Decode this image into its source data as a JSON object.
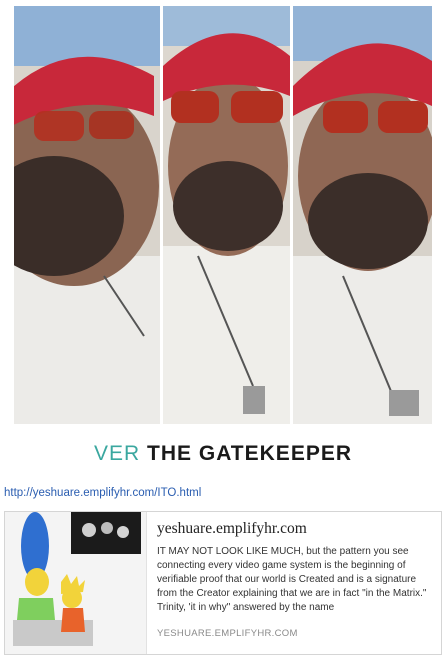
{
  "caption": {
    "prefix": "VER",
    "title": "THE GATEKEEPER"
  },
  "link": {
    "url": "http://yeshuare.emplifyhr.com/ITO.html"
  },
  "preview_card": {
    "title": "yeshuare.emplifyhr.com",
    "description": "IT MAY NOT LOOK LIKE MUCH, but the pattern you see connecting every video game system is the beginning of verifiable proof that our world is Created and is a signature from the Creator explaining that we are in fact \"in the Matrix.\"  Trinity, 'it in why\" answered by the name",
    "domain": "YESHUARE.EMPLIFYHR.COM",
    "thumbnail_icon": "simpsons-marge-lisa-illustration"
  },
  "colors": {
    "caption_accent": "#3aa79f",
    "link": "#2a5db0",
    "cap_red": "#c8283a"
  }
}
